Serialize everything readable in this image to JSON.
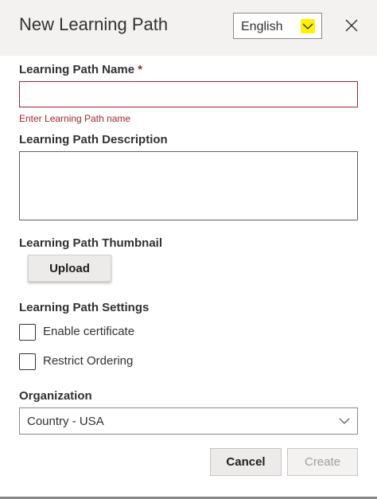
{
  "dialog": {
    "title": "New Learning Path",
    "close_icon": "close-icon"
  },
  "language": {
    "selected": "English",
    "chevron_icon": "chevron-down-icon",
    "highlight_color": "#fff200"
  },
  "form": {
    "name_label": "Learning Path Name",
    "required_mark": "*",
    "name_value": "",
    "name_error": "Enter Learning Path name",
    "description_label": "Learning Path Description",
    "description_value": "",
    "thumbnail_label": "Learning Path Thumbnail",
    "upload_label": "Upload",
    "settings_label": "Learning Path Settings",
    "settings": [
      {
        "label": "Enable certificate",
        "checked": false
      },
      {
        "label": "Restrict Ordering",
        "checked": false
      }
    ],
    "organization_label": "Organization",
    "organization_selected": "Country - USA"
  },
  "actions": {
    "cancel_label": "Cancel",
    "create_label": "Create"
  },
  "colors": {
    "error": "#a4262c",
    "header_bg": "#f3f2f1"
  }
}
